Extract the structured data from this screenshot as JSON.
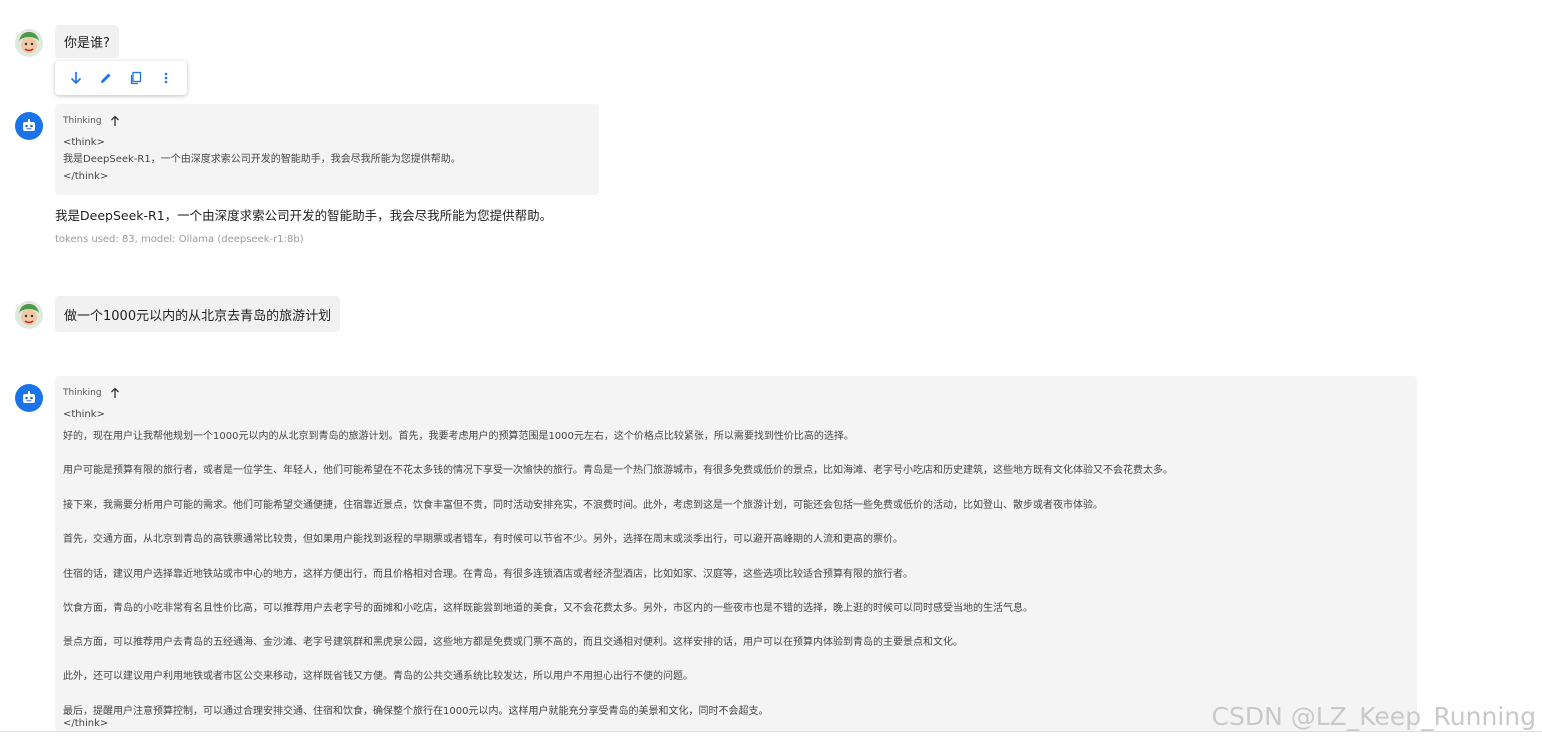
{
  "messages": {
    "user1": "你是谁?",
    "bot1": {
      "thinking_label": "Thinking",
      "think_lines": [
        "<think>",
        "我是DeepSeek-R1，一个由深度求索公司开发的智能助手，我会尽我所能为您提供帮助。",
        "</think>"
      ],
      "answer": "我是DeepSeek-R1，一个由深度求索公司开发的智能助手，我会尽我所能为您提供帮助。",
      "meta": "tokens used: 83, model: Ollama (deepseek-r1:8b)"
    },
    "user2": "做一个1000元以内的从北京去青岛的旅游计划",
    "bot2": {
      "thinking_label": "Thinking",
      "think_open": "<think>",
      "paragraphs": [
        "好的，现在用户让我帮他规划一个1000元以内的从北京到青岛的旅游计划。首先，我要考虑用户的预算范围是1000元左右，这个价格点比较紧张，所以需要找到性价比高的选择。",
        "用户可能是预算有限的旅行者，或者是一位学生、年轻人，他们可能希望在不花太多钱的情况下享受一次愉快的旅行。青岛是一个热门旅游城市，有很多免费或低价的景点，比如海滩、老字号小吃店和历史建筑，这些地方既有文化体验又不会花费太多。",
        "接下来，我需要分析用户可能的需求。他们可能希望交通便捷，住宿靠近景点，饮食丰富但不贵，同时活动安排充实，不浪费时间。此外，考虑到这是一个旅游计划，可能还会包括一些免费或低价的活动，比如登山、散步或者夜市体验。",
        "首先，交通方面，从北京到青岛的高铁票通常比较贵，但如果用户能找到返程的早期票或者错车，有时候可以节省不少。另外，选择在周末或淡季出行，可以避开高峰期的人流和更高的票价。",
        "住宿的话，建议用户选择靠近地铁站或市中心的地方，这样方便出行，而且价格相对合理。在青岛，有很多连锁酒店或者经济型酒店，比如如家、汉庭等，这些选项比较适合预算有限的旅行者。",
        "饮食方面，青岛的小吃非常有名且性价比高，可以推荐用户去老字号的面摊和小吃店，这样既能尝到地道的美食，又不会花费太多。另外，市区内的一些夜市也是不错的选择，晚上逛的时候可以同时感受当地的生活气息。",
        "景点方面，可以推荐用户去青岛的五经通海、金沙滩、老字号建筑群和黑虎泉公园，这些地方都是免费或门票不高的，而且交通相对便利。这样安排的话，用户可以在预算内体验到青岛的主要景点和文化。",
        "此外，还可以建议用户利用地铁或者市区公交来移动，这样既省钱又方便。青岛的公共交通系统比较发达，所以用户不用担心出行不便的问题。",
        "最后，提醒用户注意预算控制，可以通过合理安排交通、住宿和饮食，确保整个旅行在1000元以内。这样用户就能充分享受青岛的美景和文化，同时不会超支。"
      ],
      "think_close": "</think>"
    }
  },
  "toolbar": {
    "icons": [
      "arrow-down-icon",
      "edit-icon",
      "copy-icon",
      "more-icon"
    ]
  },
  "watermark": "CSDN @LZ_Keep_Running",
  "colors": {
    "accent": "#1a73e8",
    "bubble": "#f1f1f1",
    "think_bg": "#f4f4f4"
  }
}
